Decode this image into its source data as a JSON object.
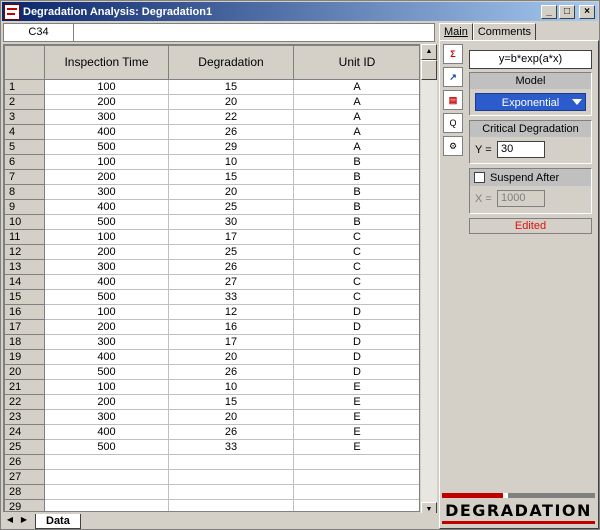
{
  "window": {
    "title": "Degradation Analysis: Degradation1",
    "controls": [
      "_",
      "□",
      "×"
    ]
  },
  "cellbar": {
    "ref": "C34",
    "value": ""
  },
  "grid": {
    "headers": [
      "",
      "Inspection Time",
      "Degradation",
      "Unit ID"
    ],
    "rows": [
      [
        "1",
        "100",
        "15",
        "A"
      ],
      [
        "2",
        "200",
        "20",
        "A"
      ],
      [
        "3",
        "300",
        "22",
        "A"
      ],
      [
        "4",
        "400",
        "26",
        "A"
      ],
      [
        "5",
        "500",
        "29",
        "A"
      ],
      [
        "6",
        "100",
        "10",
        "B"
      ],
      [
        "7",
        "200",
        "15",
        "B"
      ],
      [
        "8",
        "300",
        "20",
        "B"
      ],
      [
        "9",
        "400",
        "25",
        "B"
      ],
      [
        "10",
        "500",
        "30",
        "B"
      ],
      [
        "11",
        "100",
        "17",
        "C"
      ],
      [
        "12",
        "200",
        "25",
        "C"
      ],
      [
        "13",
        "300",
        "26",
        "C"
      ],
      [
        "14",
        "400",
        "27",
        "C"
      ],
      [
        "15",
        "500",
        "33",
        "C"
      ],
      [
        "16",
        "100",
        "12",
        "D"
      ],
      [
        "17",
        "200",
        "16",
        "D"
      ],
      [
        "18",
        "300",
        "17",
        "D"
      ],
      [
        "19",
        "400",
        "20",
        "D"
      ],
      [
        "20",
        "500",
        "26",
        "D"
      ],
      [
        "21",
        "100",
        "10",
        "E"
      ],
      [
        "22",
        "200",
        "15",
        "E"
      ],
      [
        "23",
        "300",
        "20",
        "E"
      ],
      [
        "24",
        "400",
        "26",
        "E"
      ],
      [
        "25",
        "500",
        "33",
        "E"
      ],
      [
        "26",
        "",
        "",
        ""
      ],
      [
        "27",
        "",
        "",
        ""
      ],
      [
        "28",
        "",
        "",
        ""
      ],
      [
        "29",
        "",
        "",
        ""
      ]
    ]
  },
  "sheet_tabs": {
    "active": "Data"
  },
  "panel": {
    "tabs": [
      "Main",
      "Comments"
    ],
    "formula": "y=b*exp(a*x)",
    "model": {
      "title": "Model",
      "selected": "Exponential"
    },
    "critical": {
      "title": "Critical Degradation",
      "label": "Y =",
      "value": "30"
    },
    "suspend": {
      "title": "Suspend After",
      "label": "X =",
      "value": "1000"
    },
    "status": "Edited",
    "logo": "DEGRADATION"
  },
  "colors": {
    "titlebar_start": "#0a246a",
    "dropdown": "#2c5ccc",
    "status_text": "#e01010",
    "logo_red": "#c00000"
  }
}
